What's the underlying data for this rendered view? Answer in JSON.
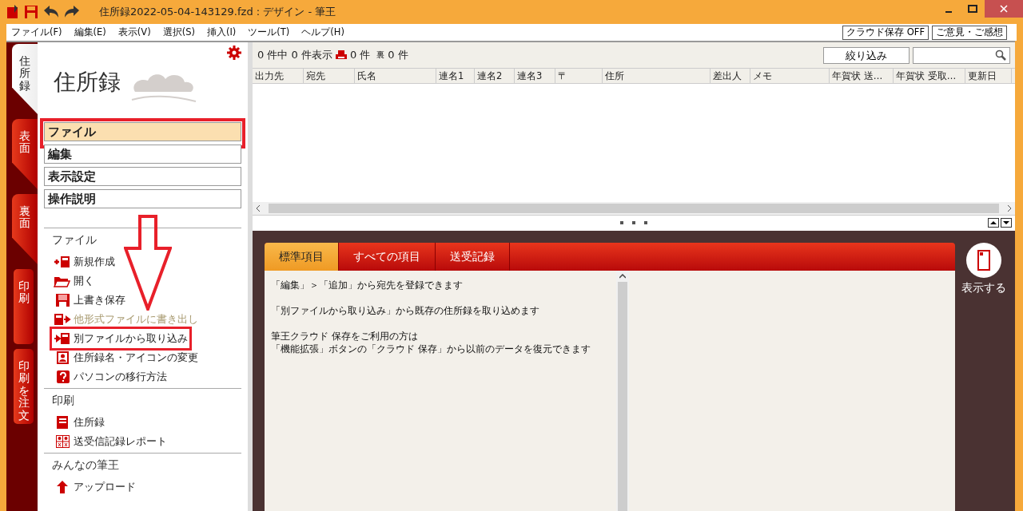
{
  "window": {
    "title": "住所録2022-05-04-143129.fzd : デザイン - 筆王"
  },
  "menu": [
    "ファイル(F)",
    "編集(E)",
    "表示(V)",
    "選択(S)",
    "挿入(I)",
    "ツール(T)",
    "ヘルプ(H)"
  ],
  "menu_buttons": [
    "クラウド保存 OFF",
    "ご意見・ご感想"
  ],
  "side_tabs": [
    {
      "label": "住所録",
      "kind": "section",
      "selected": true
    },
    {
      "label": "表面",
      "kind": "section",
      "selected": false
    },
    {
      "label": "裏面",
      "kind": "section",
      "selected": false
    },
    {
      "label": "印刷",
      "kind": "button",
      "selected": false
    },
    {
      "label": "印刷を注文",
      "kind": "button",
      "selected": false
    }
  ],
  "sidebar": {
    "title": "住所録",
    "menu_buttons": [
      {
        "label": "ファイル",
        "selected": true,
        "highlighted": true
      },
      {
        "label": "編集",
        "selected": false,
        "highlighted": false
      },
      {
        "label": "表示設定",
        "selected": false,
        "highlighted": false
      },
      {
        "label": "操作説明",
        "selected": false,
        "highlighted": false
      }
    ],
    "sections": [
      {
        "heading": "ファイル",
        "items": [
          {
            "label": "新規作成",
            "kind": "new",
            "disabled": false,
            "highlighted": false
          },
          {
            "label": "開く",
            "kind": "open",
            "disabled": false,
            "highlighted": false
          },
          {
            "label": "上書き保存",
            "kind": "save",
            "disabled": false,
            "highlighted": false
          },
          {
            "label": "他形式ファイルに書き出し",
            "kind": "export",
            "disabled": true,
            "highlighted": false
          },
          {
            "label": "別ファイルから取り込み",
            "kind": "import",
            "disabled": false,
            "highlighted": true
          },
          {
            "label": "住所録名・アイコンの変更",
            "kind": "person",
            "disabled": false,
            "highlighted": false
          },
          {
            "label": "パソコンの移行方法",
            "kind": "help",
            "disabled": false,
            "highlighted": false
          }
        ]
      },
      {
        "heading": "印刷",
        "items": [
          {
            "label": "住所録",
            "kind": "book",
            "disabled": false,
            "highlighted": false
          },
          {
            "label": "送受信記録レポート",
            "kind": "report",
            "disabled": false,
            "highlighted": false
          }
        ]
      },
      {
        "heading": "みんなの筆王",
        "items": [
          {
            "label": "アップロード",
            "kind": "upload",
            "disabled": false,
            "highlighted": false
          }
        ]
      }
    ]
  },
  "toolbar": {
    "count": "0 件中 0 件表示",
    "front_count": "0 件",
    "back_label": "裏",
    "back_count": "0 件",
    "filter_button": "絞り込み"
  },
  "table": {
    "columns": [
      "出力先",
      "宛先",
      "氏名",
      "連名1",
      "連名2",
      "連名3",
      "〒",
      "住所",
      "差出人",
      "メモ",
      "年賀状 送…",
      "年賀状 受取…",
      "更新日"
    ]
  },
  "detail": {
    "tabs": [
      {
        "label": "標準項目",
        "selected": true
      },
      {
        "label": "すべての項目",
        "selected": false
      },
      {
        "label": "送受記録",
        "selected": false
      }
    ],
    "paragraphs": [
      [
        "「編集」＞「追加」から宛先を登録できます"
      ],
      [
        "「別ファイルから取り込み」から既存の住所録を取り込めます"
      ],
      [
        "筆王クラウド 保存をご利用の方は",
        "「機能拡張」ボタンの「クラウド 保存」から以前のデータを復元できます"
      ]
    ],
    "show_button": "表示する"
  }
}
